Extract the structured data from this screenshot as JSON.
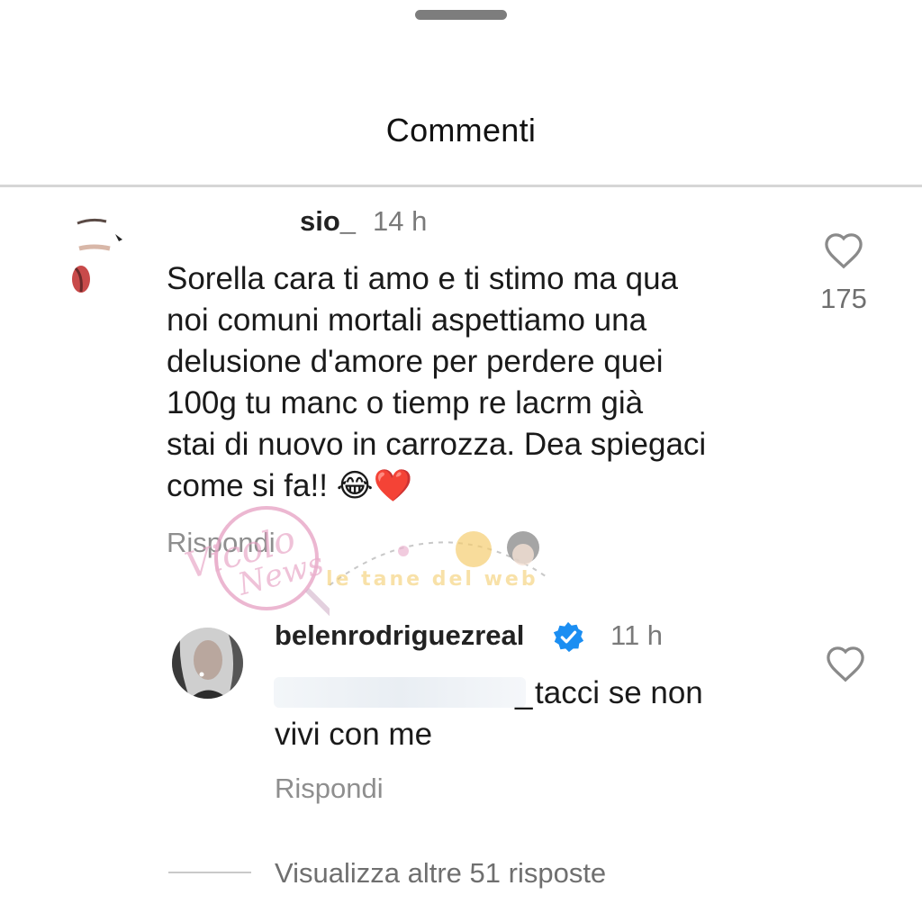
{
  "sheet": {
    "title": "Commenti"
  },
  "comments": [
    {
      "username": "sio_",
      "time": "14 h",
      "text_lines": [
        "Sorella cara ti amo e ti stimo ma qua",
        "noi comuni mortali aspettiamo una",
        "delusione d'amore per perdere quei",
        "100g tu manc o tiemp re lacrm già",
        "stai di nuovo in carrozza. Dea spiegaci",
        "come si fa!! 😂❤️"
      ],
      "likes": "175",
      "reply_label": "Rispondi"
    }
  ],
  "reply": {
    "username": "belenrodriguezreal",
    "verified_icon": "verified-badge-icon",
    "time": "11 h",
    "mention_tail": "_",
    "text_first": "tacci se non",
    "text_second": "vivi con me",
    "reply_label": "Rispondi"
  },
  "view_more": "Visualizza altre 51 risposte",
  "watermarks": {
    "left": "Vicolo delle News",
    "right": "le tane del web"
  },
  "colors": {
    "verified": "#1b8ef2",
    "muted": "#8e8e8e",
    "watermark_pink": "#e6a1c3",
    "watermark_gold": "#f2c14b"
  }
}
